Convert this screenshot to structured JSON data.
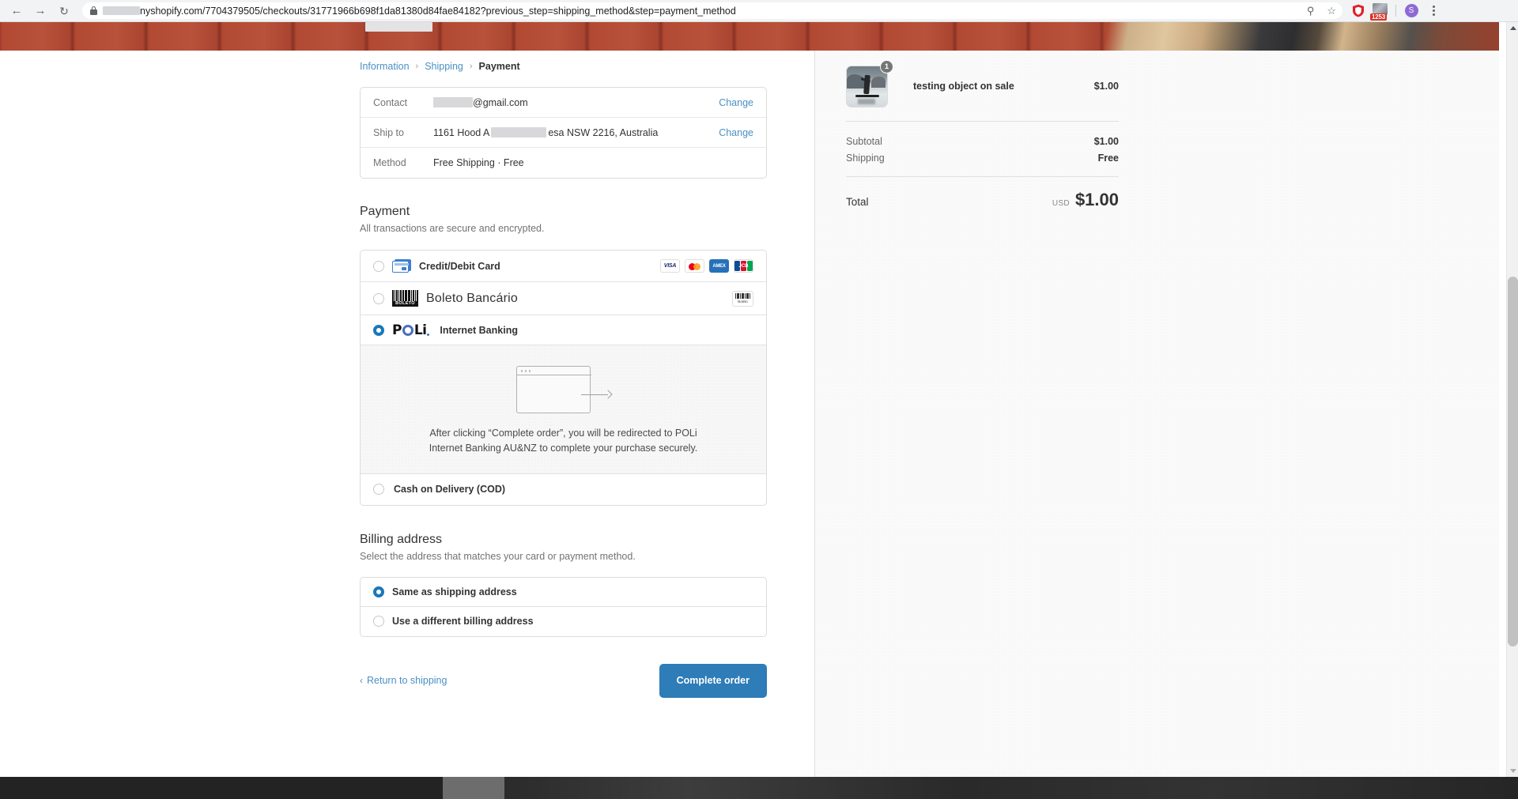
{
  "browser": {
    "back_icon": "back-arrow-icon",
    "forward_icon": "forward-arrow-icon",
    "reload_icon": "reload-icon",
    "lock_icon": "lock-icon",
    "url_prefix_redacted": "",
    "url_text": "nyshopify.com/7704379505/checkouts/31771966b698f1da81380d84fae84182?previous_step=shipping_method&step=payment_method",
    "search_page_icon": "search-icon",
    "bookmark_icon": "star-icon",
    "adblock_icon": "shield-icon",
    "extension_icon": "extension-icon",
    "extension_badge_count": "1253",
    "profile_initial": "S",
    "menu_icon": "kebab-menu-icon"
  },
  "breadcrumb": {
    "information": "Information",
    "shipping": "Shipping",
    "payment": "Payment",
    "separator": "›"
  },
  "review": {
    "rows": [
      {
        "label": "Contact",
        "value": "@gmail.com",
        "redacted_width": 50,
        "change": "Change"
      },
      {
        "label": "Ship to",
        "value_pre": "1161 Hood A",
        "value_post": "esa NSW 2216, Australia",
        "redacted_width": 70,
        "change": "Change"
      },
      {
        "label": "Method",
        "value": "Free Shipping · Free",
        "change": ""
      }
    ]
  },
  "payment_section": {
    "title": "Payment",
    "subtitle": "All transactions are secure and encrypted.",
    "methods": [
      {
        "id": "credit-debit-card",
        "label": "Credit/Debit Card",
        "selected": false,
        "icon": "credit-card-icon",
        "brands": [
          "VISA",
          "Mastercard",
          "AMEX",
          "JCB"
        ]
      },
      {
        "id": "boleto-bancario",
        "label": "Boleto Bancário",
        "selected": false,
        "icon": "barcode-icon",
        "icon_word": "BOLETO",
        "badge_word": "Boleto"
      },
      {
        "id": "poli-internet-banking",
        "label": "Internet Banking",
        "logo_text": "POLi",
        "selected": true,
        "icon": "poli-logo-icon"
      },
      {
        "id": "cash-on-delivery",
        "label": "Cash on Delivery (COD)",
        "selected": false
      }
    ],
    "redirect_notice_line1": "After clicking “Complete order”, you will be redirected to POLi",
    "redirect_notice_line2": "Internet Banking AU&NZ to complete your purchase securely.",
    "redirect_art_icon": "browser-window-redirect-icon"
  },
  "billing_section": {
    "title": "Billing address",
    "subtitle": "Select the address that matches your card or payment method.",
    "options": [
      {
        "id": "same-as-shipping",
        "label": "Same as shipping address",
        "selected": true
      },
      {
        "id": "different-billing",
        "label": "Use a different billing address",
        "selected": false
      }
    ]
  },
  "actions": {
    "return_link": "Return to shipping",
    "return_chevron": "‹",
    "complete_button": "Complete order"
  },
  "summary": {
    "item": {
      "name": "testing object on sale",
      "price": "$1.00",
      "quantity": "1",
      "thumbnail_alt": "surfer-product-thumbnail"
    },
    "lines": [
      {
        "key": "Subtotal",
        "value": "$1.00"
      },
      {
        "key": "Shipping",
        "value": "Free"
      }
    ],
    "total": {
      "key": "Total",
      "currency": "USD",
      "amount": "$1.00"
    }
  },
  "colors": {
    "accent": "#2e7cb8",
    "link": "#4a90c4",
    "radio_selected": "#1878b9",
    "banner_brick": "#a8432f",
    "badge_red": "#d93025",
    "avatar_purple": "#8e69d4"
  }
}
